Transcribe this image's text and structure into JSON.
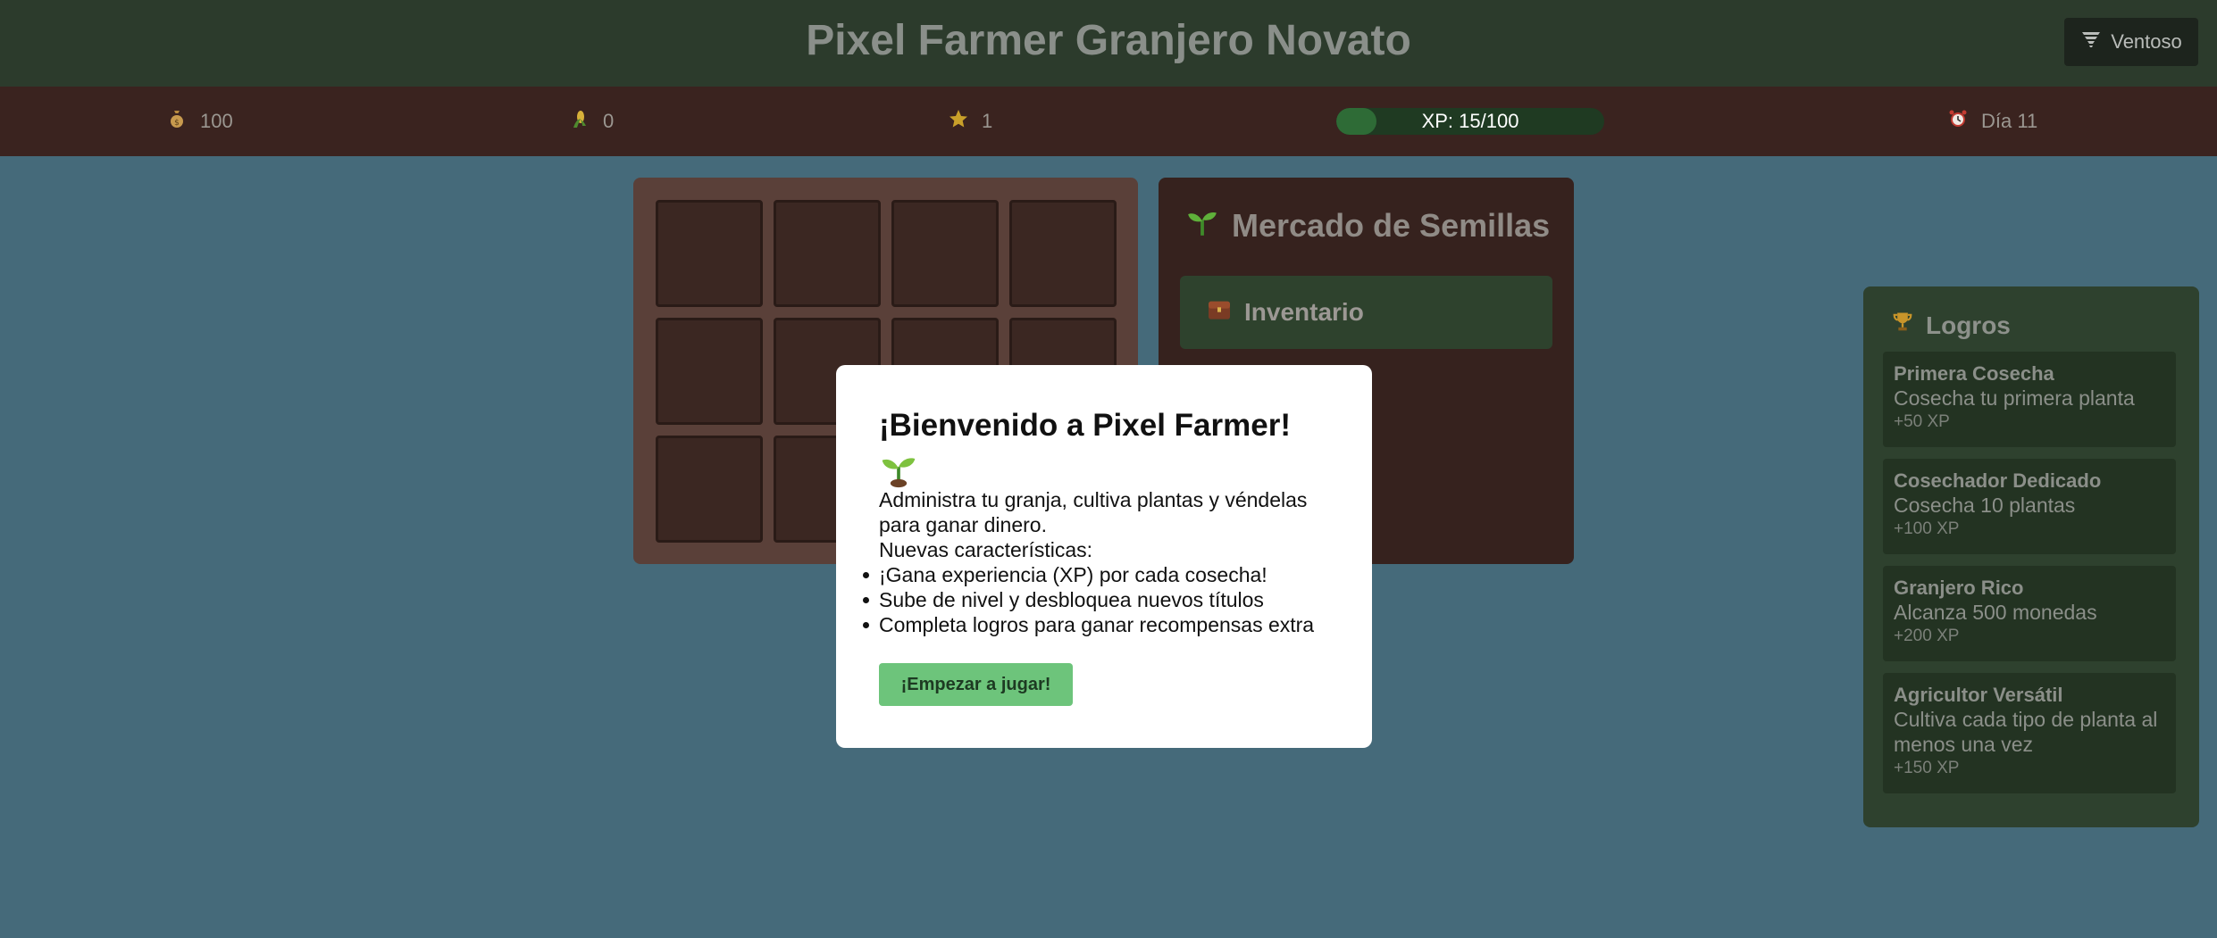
{
  "header": {
    "title": "Pixel Farmer Granjero Novato",
    "weather_label": "Ventoso",
    "weather_icon": "tornado-icon"
  },
  "stats": {
    "money": "100",
    "money_icon": "money-bag-icon",
    "crops": "0",
    "crops_icon": "corn-icon",
    "level": "1",
    "level_icon": "star-icon",
    "xp_text": "XP: 15/100",
    "xp_progress": 0.15,
    "day": "Día 11",
    "day_icon": "alarm-clock-icon"
  },
  "farm": {
    "plots": 12
  },
  "market": {
    "title": "Mercado de Semillas",
    "title_icon": "seedling-icon",
    "inventory_label": "Inventario",
    "inventory_icon": "chest-icon"
  },
  "achievements": {
    "title": "Logros",
    "title_icon": "trophy-icon",
    "items": [
      {
        "name": "Primera Cosecha",
        "desc": "Cosecha tu primera planta",
        "xp": "+50 XP"
      },
      {
        "name": "Cosechador Dedicado",
        "desc": "Cosecha 10 plantas",
        "xp": "+100 XP"
      },
      {
        "name": "Granjero Rico",
        "desc": "Alcanza 500 monedas",
        "xp": "+200 XP"
      },
      {
        "name": "Agricultor Versátil",
        "desc": "Cultiva cada tipo de planta al menos una vez",
        "xp": "+150 XP"
      }
    ]
  },
  "modal": {
    "title": "¡Bienvenido a Pixel Farmer!",
    "title_icon": "seedling-icon",
    "intro": "Administra tu granja, cultiva plantas y véndelas para ganar dinero.",
    "features_heading": "Nuevas características:",
    "features": [
      "¡Gana experiencia (XP) por cada cosecha!",
      "Sube de nivel y desbloquea nuevos títulos",
      "Completa logros para ganar recompensas extra"
    ],
    "start_button": "¡Empezar a jugar!"
  },
  "colors": {
    "header_bg": "#2c3b2c",
    "stats_bg": "#3a231f",
    "page_bg": "#456a7a",
    "start_button": "#6dc47b"
  }
}
